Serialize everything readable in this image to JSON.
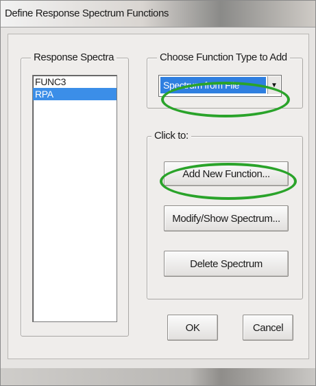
{
  "window": {
    "title": "Define Response Spectrum Functions"
  },
  "response_spectra": {
    "legend": "Response Spectra",
    "items": [
      {
        "label": "FUNC3",
        "selected": false
      },
      {
        "label": "RPA",
        "selected": true
      }
    ]
  },
  "function_type": {
    "legend": "Choose Function Type to Add",
    "selected": "Spectrum from File"
  },
  "click_to": {
    "legend": "Click to:",
    "add_new_function": "Add New Function...",
    "modify_show_spectrum": "Modify/Show Spectrum...",
    "delete_spectrum": "Delete Spectrum"
  },
  "buttons": {
    "ok": "OK",
    "cancel": "Cancel"
  },
  "colors": {
    "selection": "#3b8ee8",
    "annotation": "#2aa32a"
  }
}
